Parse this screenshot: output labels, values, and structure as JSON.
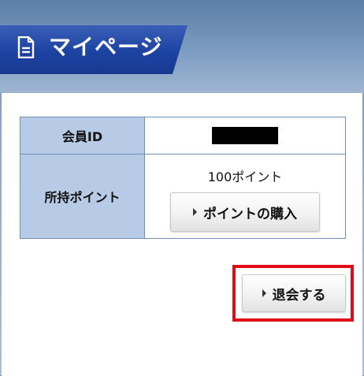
{
  "header": {
    "title": "マイページ",
    "title_icon": "document-icon",
    "tab_color": "#1d43a2"
  },
  "member_table": {
    "id_label": "会員ID",
    "id_value_masked": true,
    "points_label": "所持ポイント",
    "points_value": "100ポイント",
    "buy_button_label": "ポイントの購入",
    "header_bg": "#b7cbe6",
    "border_color": "#6e8fb8"
  },
  "actions": {
    "withdraw_label": "退会する",
    "highlight_color": "#e00c18"
  }
}
